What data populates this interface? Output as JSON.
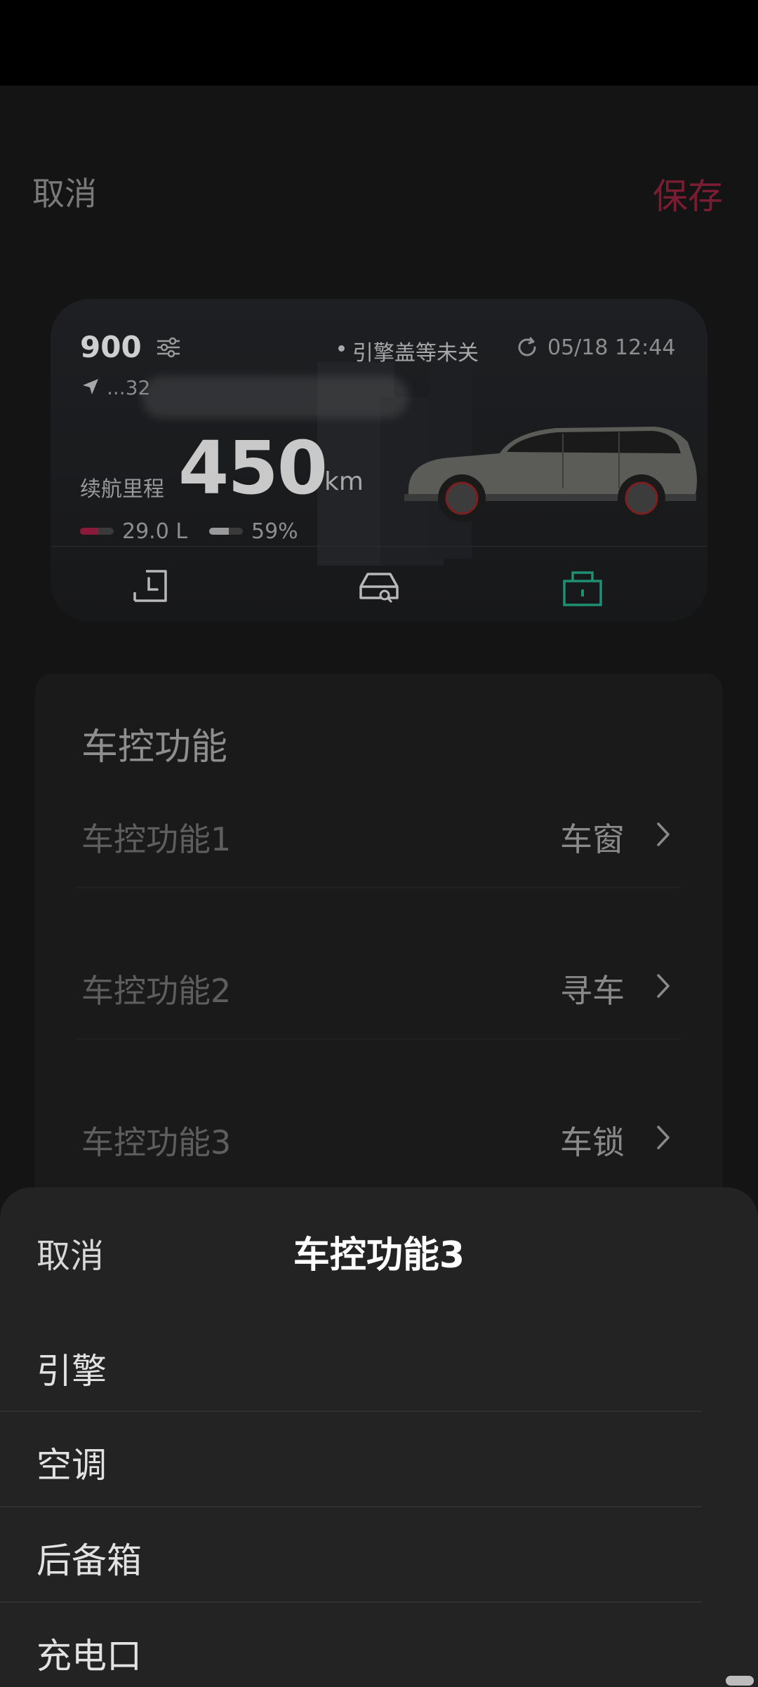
{
  "header": {
    "cancel_label": "取消",
    "save_label": "保存"
  },
  "vehicle_card": {
    "model": "900",
    "alert": "引擎盖等未关",
    "timestamp": "05/18 12:44",
    "address": "...32",
    "range_label": "续航里程",
    "range_value": "450",
    "range_unit": "km",
    "fuel_value": "29.0 L",
    "fuel_level": 0.55,
    "battery_value": "59%",
    "battery_level": 0.59,
    "controls": [
      "history-icon",
      "car-search-icon",
      "lock-icon"
    ],
    "colors": {
      "accent_green": "#1f8f72",
      "fuel_color": "#8a1a3a"
    }
  },
  "functions": {
    "title": "车控功能",
    "rows": [
      {
        "label": "车控功能1",
        "value": "车窗"
      },
      {
        "label": "车控功能2",
        "value": "寻车"
      },
      {
        "label": "车控功能3",
        "value": "车锁"
      }
    ]
  },
  "sheet": {
    "cancel_label": "取消",
    "title": "车控功能3",
    "options": [
      "引擎",
      "空调",
      "后备箱",
      "充电口"
    ]
  }
}
